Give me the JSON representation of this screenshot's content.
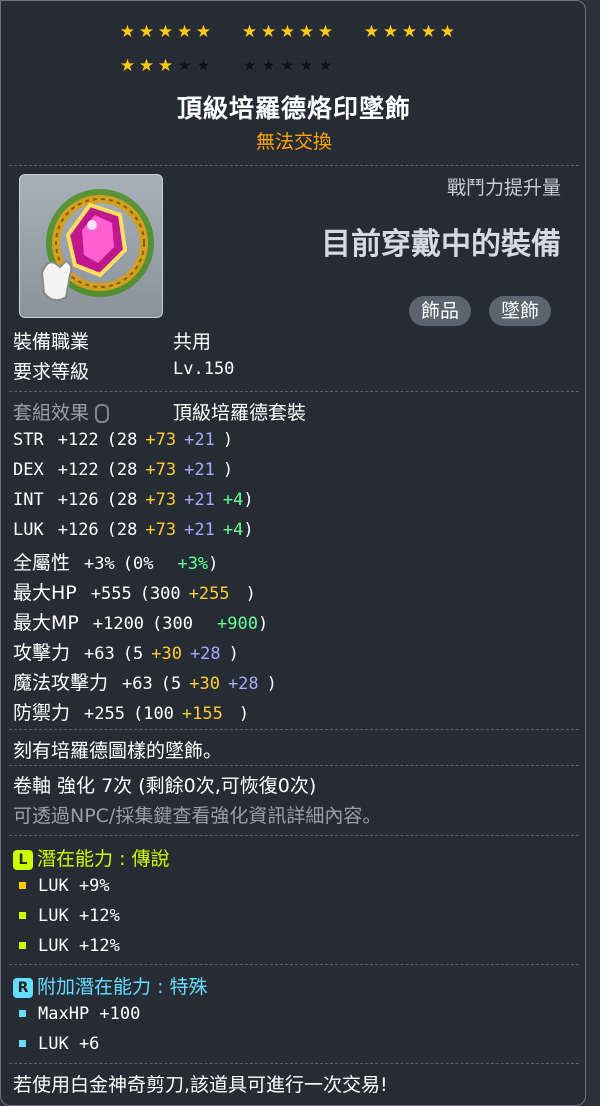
{
  "stars": {
    "filled": 18,
    "total": 25
  },
  "item": {
    "name": "頂級培羅德烙印墜飾",
    "trade_status": "無法交換",
    "icon": "pendant-gem-icon"
  },
  "combat_power": {
    "label": "戰鬥力提升量",
    "value": "目前穿戴中的裝備"
  },
  "tags": [
    "飾品",
    "墜飾"
  ],
  "requirements": [
    {
      "label": "裝備職業",
      "value": "共用"
    },
    {
      "label": "要求等級",
      "value": "Lv.150"
    }
  ],
  "set_effect": {
    "label": "套組效果",
    "value": "頂級培羅德套裝"
  },
  "stats": [
    {
      "name": "STR",
      "total": "+122",
      "base": "(28",
      "a": "+73",
      "b": "+21",
      "c": "",
      "end": ")"
    },
    {
      "name": "DEX",
      "total": "+122",
      "base": "(28",
      "a": "+73",
      "b": "+21",
      "c": "",
      "end": ")"
    },
    {
      "name": "INT",
      "total": "+126",
      "base": "(28",
      "a": "+73",
      "b": "+21",
      "c": "+4",
      "end": ")"
    },
    {
      "name": "LUK",
      "total": "+126",
      "base": "(28",
      "a": "+73",
      "b": "+21",
      "c": "+4",
      "end": ")"
    }
  ],
  "stats2": [
    {
      "name": "全屬性",
      "total": "+3%",
      "base": "(0%",
      "a": "",
      "b": "",
      "c": "+3%",
      "end": ")"
    },
    {
      "name": "最大HP",
      "total": "+555",
      "base": "(300",
      "a": "+255",
      "b": "",
      "c": "",
      "end": ")"
    },
    {
      "name": "最大MP",
      "total": "+1200",
      "base": "(300",
      "a": "",
      "b": "",
      "c": "+900",
      "end": ")"
    },
    {
      "name": "攻擊力",
      "total": "+63",
      "base": "(5",
      "a": "+30",
      "b": "+28",
      "c": "",
      "end": ")"
    },
    {
      "name": "魔法攻擊力",
      "total": "+63",
      "base": "(5",
      "a": "+30",
      "b": "+28",
      "c": "",
      "end": ")"
    },
    {
      "name": "防禦力",
      "total": "+255",
      "base": "(100",
      "a": "+155",
      "b": "",
      "c": "",
      "end": ")"
    }
  ],
  "description": "刻有培羅德圖樣的墜飾。",
  "scroll": "卷軸 強化 7次 (剩餘0次,可恢復0次)",
  "scroll_hint": "可透過NPC/採集鍵查看強化資訊詳細內容。",
  "potential": {
    "badge": "L",
    "label": "潛在能力",
    "sep": ":",
    "grade": "傳說",
    "lines": [
      "LUK +9%",
      "LUK +12%",
      "LUK +12%"
    ],
    "colors": [
      "#ffcc00",
      "#ccff00",
      "#ccff00"
    ]
  },
  "bonus_potential": {
    "badge": "R",
    "label": "附加潛在能力",
    "sep": ":",
    "grade": "特殊",
    "lines": [
      "MaxHP +100",
      "LUK +6"
    ]
  },
  "footer": "若使用白金神奇剪刀,該道具可進行一次交易!"
}
